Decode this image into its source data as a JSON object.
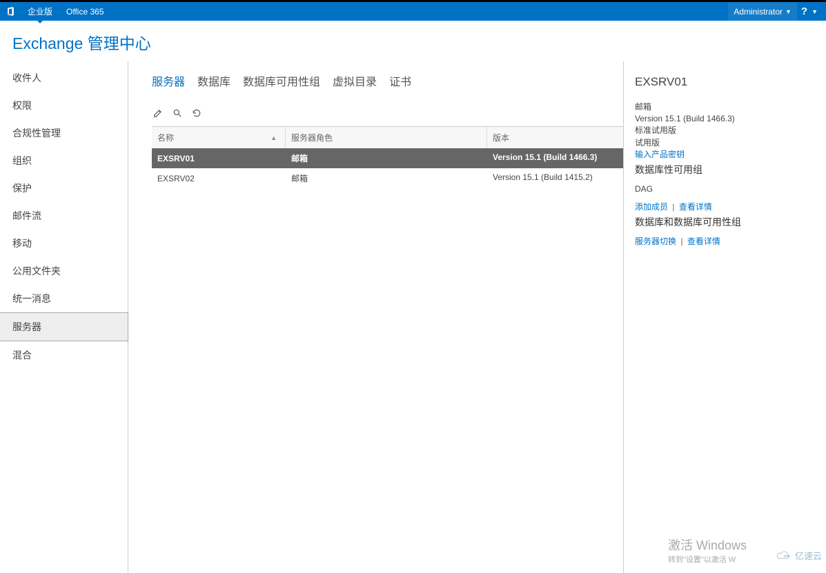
{
  "topbar": {
    "enterprise": "企业版",
    "office365": "Office 365",
    "user": "Administrator",
    "help": "?"
  },
  "title": "Exchange 管理中心",
  "sidebar": {
    "items": [
      {
        "label": "收件人"
      },
      {
        "label": "权限"
      },
      {
        "label": "合规性管理"
      },
      {
        "label": "组织"
      },
      {
        "label": "保护"
      },
      {
        "label": "邮件流"
      },
      {
        "label": "移动"
      },
      {
        "label": "公用文件夹"
      },
      {
        "label": "统一消息"
      },
      {
        "label": "服务器",
        "active": true
      },
      {
        "label": "混合"
      }
    ]
  },
  "tabs": [
    {
      "label": "服务器",
      "active": true
    },
    {
      "label": "数据库"
    },
    {
      "label": "数据库可用性组"
    },
    {
      "label": "虚拟目录"
    },
    {
      "label": "证书"
    }
  ],
  "toolbar": {
    "edit": "edit",
    "search": "search",
    "refresh": "refresh"
  },
  "table": {
    "columns": {
      "name": "名称",
      "role": "服务器角色",
      "version": "版本"
    },
    "rows": [
      {
        "name": "EXSRV01",
        "role": "邮箱",
        "version": "Version 15.1 (Build 1466.3)",
        "selected": true
      },
      {
        "name": "EXSRV02",
        "role": "邮箱",
        "version": "Version 15.1 (Build 1415.2)"
      }
    ]
  },
  "details": {
    "title": "EXSRV01",
    "role": "邮箱",
    "version": "Version 15.1 (Build 1466.3)",
    "edition": "标准试用版",
    "license": "试用版",
    "enter_key": "输入产品密钥",
    "dag_heading": "数据库性可用组",
    "dag_name": "DAG",
    "add_member": "添加成员",
    "view_details": "查看详情",
    "db_dag_heading": "数据库和数据库可用性组",
    "switchover": "服务器切换",
    "view_details2": "查看详情",
    "separator": "|"
  },
  "watermark": {
    "title": "激活 Windows",
    "subtitle": "转到\"设置\"以激活 W"
  },
  "brand": "亿速云"
}
